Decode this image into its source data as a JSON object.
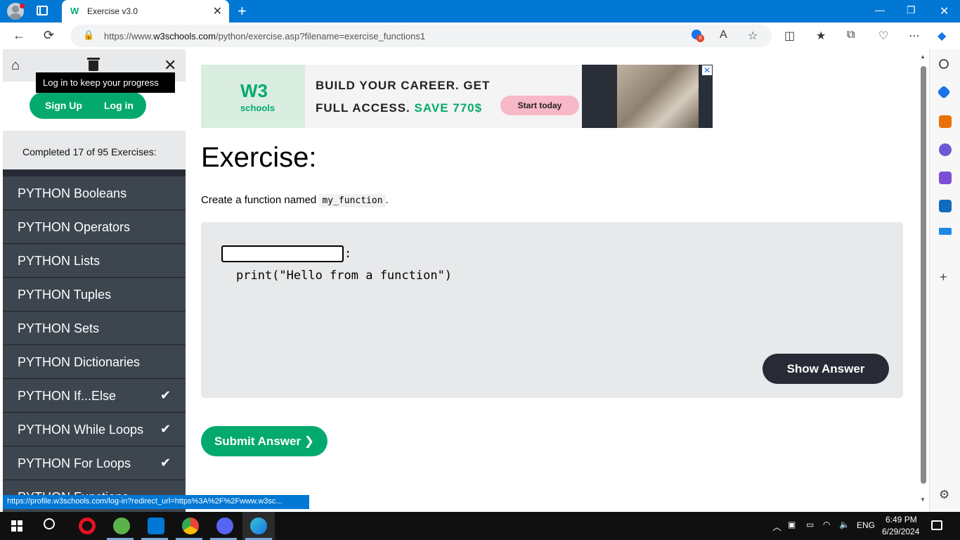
{
  "browser": {
    "tab_title": "Exercise v3.0",
    "tab_favicon": "W",
    "url_prefix": "https://www.",
    "url_domain": "w3schools.com",
    "url_path": "/python/exercise.asp?filename=exercise_functions1",
    "badge_count": "8",
    "status_url": "https://profile.w3schools.com/log-in?redirect_url=https%3A%2F%2Fwww.w3sc..."
  },
  "sidebar": {
    "signup_label": "Sign Up",
    "login_label": "Log in",
    "tooltip": "Log in to keep your progress",
    "progress_text": "Completed 17 of 95 Exercises:",
    "items": [
      {
        "label": "PYTHON Booleans",
        "done": false
      },
      {
        "label": "PYTHON Operators",
        "done": false
      },
      {
        "label": "PYTHON Lists",
        "done": false
      },
      {
        "label": "PYTHON Tuples",
        "done": false
      },
      {
        "label": "PYTHON Sets",
        "done": false
      },
      {
        "label": "PYTHON Dictionaries",
        "done": false
      },
      {
        "label": "PYTHON If...Else",
        "done": true
      },
      {
        "label": "PYTHON While Loops",
        "done": true
      },
      {
        "label": "PYTHON For Loops",
        "done": true
      },
      {
        "label": "PYTHON Functions",
        "done": false
      }
    ]
  },
  "ad": {
    "logo_text": "schools",
    "logo_mark": "W3",
    "line1": "BUILD YOUR CAREER. GET",
    "line2_prefix": "FULL ACCESS. ",
    "line2_highlight": "SAVE 770$",
    "cta": "Start today"
  },
  "exercise": {
    "title": "Exercise:",
    "desc_prefix": "Create a function named ",
    "desc_code": "my_function",
    "desc_suffix": ".",
    "input_value": "",
    "colon": ":",
    "code_line": "print(\"Hello from a function\")",
    "show_answer": "Show Answer",
    "submit": "Submit Answer ❯"
  },
  "taskbar": {
    "lang": "ENG",
    "time": "6:49 PM",
    "date": "6/29/2024"
  },
  "colors": {
    "accent": "#04aa6d",
    "dark": "#282a35",
    "browser_blue": "#0078d4"
  }
}
